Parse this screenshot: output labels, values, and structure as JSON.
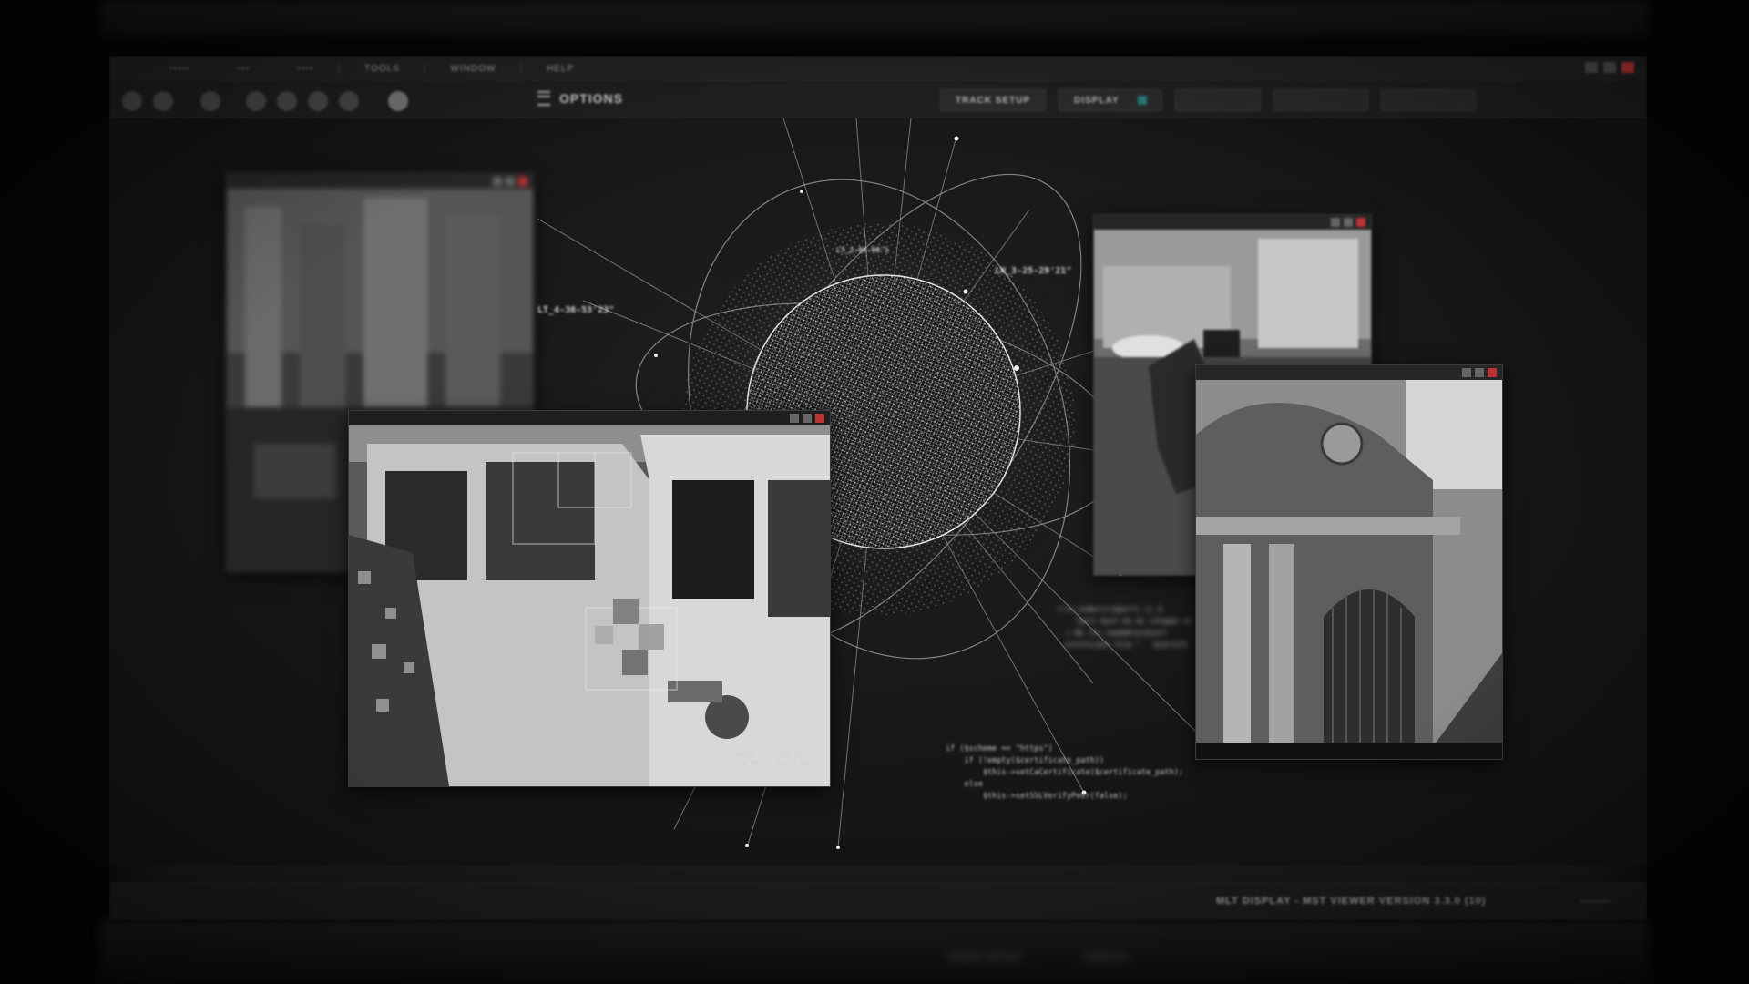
{
  "menu": {
    "items": [
      "TOOLS",
      "WINDOW",
      "HELP"
    ]
  },
  "toolbar": {
    "options_label": "OPTIONS",
    "tabs": [
      "TRACK SETUP",
      "DISPLAY"
    ]
  },
  "overlay_labels": {
    "left": "LT_4-36-53'23\"",
    "top": "LT_2-06-08'1",
    "right": "LN_3-25-29'21\""
  },
  "code_snippet": {
    "line1": "if ($scheme == \"https\")",
    "line2": "    if (!empty($certificate_path))",
    "line3": "        $this->setCaCertificate($certificate_path);",
    "line4": "    else",
    "line5": "        $this->setSSLVerifyPeer(false);",
    "upper": "(!is_numeric($port) || $\n    \"port must be an integer or\n  ) && (is_readable($cert\n  ertificate file \"   $certifi"
  },
  "feed_readouts": {
    "van_left": "MACHE\n5.70 KM",
    "van_right": "ASC SAT\n15.77 KM"
  },
  "status": {
    "text": "MLT  DISPLAY - MST VIEWER  VERSION 3.3.0 (10)"
  },
  "colors": {
    "accent_teal": "#2a7d7b",
    "close_red": "#c63a3a"
  }
}
